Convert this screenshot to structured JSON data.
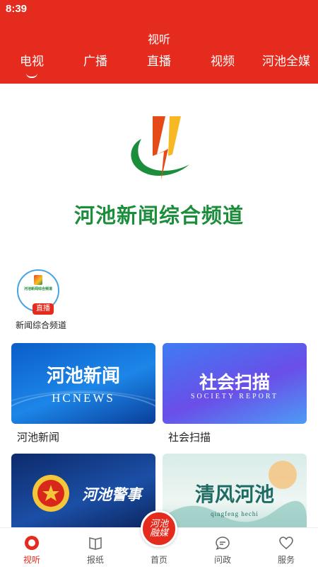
{
  "status": {
    "time": "8:39"
  },
  "header": {
    "title": "视听",
    "tabs": [
      {
        "label": "电视",
        "active": true
      },
      {
        "label": "广播",
        "active": false
      },
      {
        "label": "直播",
        "active": false
      },
      {
        "label": "视频",
        "active": false
      },
      {
        "label": "河池全媒",
        "active": false
      }
    ]
  },
  "hero": {
    "title": "河池新闻综合频道"
  },
  "live_channel": {
    "badge": "直播",
    "name": "新闻综合频道",
    "avatar_text": "河池新闻综合频道"
  },
  "programs": [
    {
      "name": "河池新闻",
      "thumb_title": "河池新闻",
      "thumb_sub": "HCNEWS"
    },
    {
      "name": "社会扫描",
      "thumb_title": "社会扫描",
      "thumb_sub": "SOCIETY REPORT"
    },
    {
      "name": "",
      "thumb_title": "河池警事",
      "thumb_sub": ""
    },
    {
      "name": "",
      "thumb_title": "清风河池",
      "thumb_sub": "qingfeng hechi"
    }
  ],
  "bottom_nav": {
    "items": [
      {
        "label": "视听",
        "icon": "play-circle-icon",
        "active": true
      },
      {
        "label": "报纸",
        "icon": "book-icon",
        "active": false
      },
      {
        "label": "首页",
        "icon": "home-icon",
        "active": false
      },
      {
        "label": "问政",
        "icon": "chat-bubble-icon",
        "active": false
      },
      {
        "label": "服务",
        "icon": "heart-icon",
        "active": false
      }
    ],
    "home_button_text": "河池融媒"
  },
  "colors": {
    "brand_red": "#e42b1e",
    "logo_green": "#1c8d3b"
  }
}
